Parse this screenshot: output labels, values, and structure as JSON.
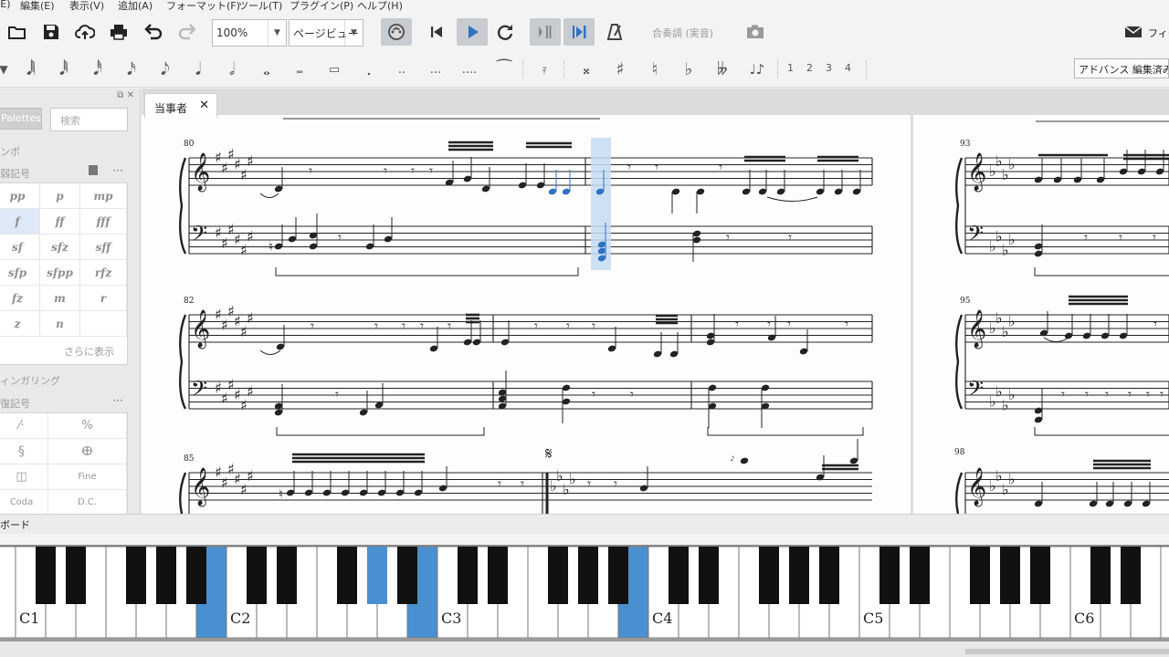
{
  "menu": [
    "(E)",
    "編集(E)",
    "表示(V)",
    "追加(A)",
    "フォーマット(F)",
    "ツール(T)",
    "プラグイン(P)",
    "ヘルプ(H)"
  ],
  "toolbar": {
    "zoom_value": "100%",
    "view_mode": "ページビュー",
    "concert_pitch": "合奏調 (実音)",
    "feedback": "フィー"
  },
  "notebar": {
    "voices": [
      "1",
      "2",
      "3",
      "4"
    ],
    "advanced_workspace": "アドバンス 編集済み"
  },
  "palette": {
    "tab": "Palettes",
    "search_placeholder": "検索",
    "section_tempo": "ンポ",
    "section_dynamics": "弱記号",
    "dynamics": [
      "pp",
      "p",
      "mp",
      "f",
      "ff",
      "fff",
      "sf",
      "sfz",
      "sff",
      "sfp",
      "sfpp",
      "rfz",
      "fz",
      "m",
      "r",
      "z",
      "n"
    ],
    "more": "さらに表示",
    "section_fingering": "ィンガリング",
    "section_repeats": "復記号",
    "repeats": [
      "Fine",
      "Coda",
      "D.C."
    ]
  },
  "score": {
    "tab_title": "当事者",
    "close_glyph": "✕",
    "measure_numbers": [
      "80",
      "82",
      "85",
      "93",
      "95",
      "98"
    ]
  },
  "piano": {
    "panel_title": "ボード",
    "octave_labels": [
      "C1",
      "C2",
      "C3",
      "C4",
      "C5",
      "C6"
    ],
    "highlight_color": "#4a8fd0"
  }
}
